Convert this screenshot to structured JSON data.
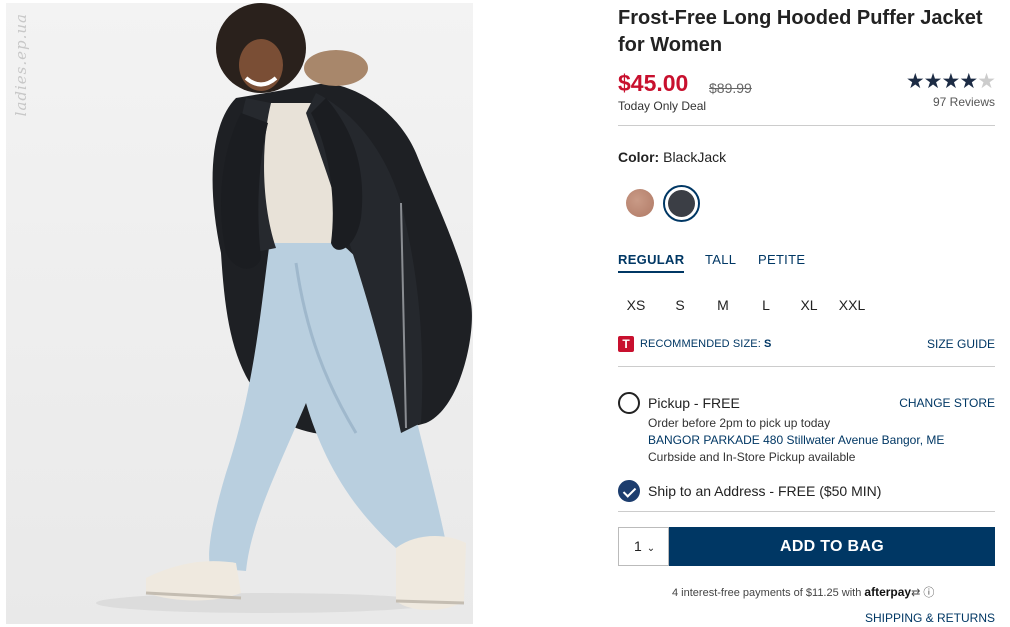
{
  "image": {
    "alt": "Woman walking in a long black hooded puffer jacket with light wash jeans and white sneakers",
    "watermark": "ladies.ep.ua"
  },
  "product": {
    "title": "Frost-Free Long Hooded Puffer Jacket for Women",
    "price": "$45.00",
    "was_price": "$89.99",
    "deal": "Today Only Deal",
    "rating": 4,
    "stars_on": "★★★★",
    "stars_off": "★",
    "reviews": "97 Reviews"
  },
  "color": {
    "label": "Color:",
    "value": "BlackJack",
    "swatches": [
      {
        "name": "Tan",
        "hex": "#b98572"
      },
      {
        "name": "BlackJack",
        "hex": "#3b3e45",
        "selected": true
      }
    ]
  },
  "fits": [
    "REGULAR",
    "TALL",
    "PETITE"
  ],
  "sizes": [
    "XS",
    "S",
    "M",
    "L",
    "XL",
    "XXL"
  ],
  "recommend": {
    "icon": "T",
    "label": "RECOMMENDED SIZE:",
    "size": "S",
    "guide": "SIZE GUIDE"
  },
  "pickup": {
    "label": "Pickup - FREE",
    "note": "Order before 2pm to pick up today",
    "store": "BANGOR PARKADE 480 Stillwater Avenue  Bangor, ME",
    "avail": "Curbside and In-Store Pickup available",
    "change": "CHANGE STORE"
  },
  "ship_address": {
    "label": "Ship to an Address - FREE ($50 MIN)"
  },
  "cart": {
    "qty": "1",
    "add_label": "ADD TO BAG"
  },
  "afterpay": {
    "text": "4 interest-free payments of $11.25 with",
    "brand": "afterpay"
  },
  "shipping_link": "SHIPPING & RETURNS",
  "colors": {
    "brand_navy": "#003764",
    "sale_red": "#c8102e"
  }
}
